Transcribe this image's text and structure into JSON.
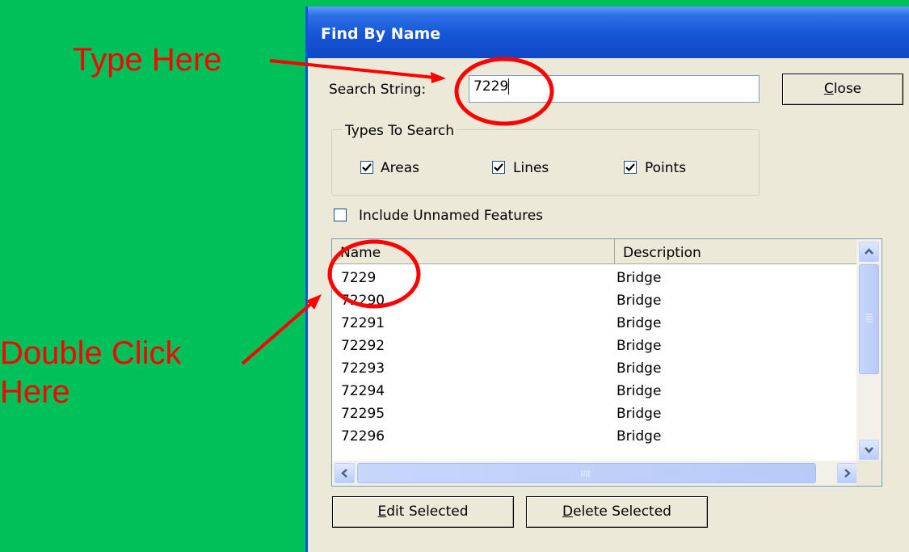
{
  "annotations": {
    "type_here": "Type Here",
    "double_click": "Double Click Here"
  },
  "window": {
    "title": "Find By Name"
  },
  "search": {
    "label": "Search String:",
    "value": "7229"
  },
  "buttons": {
    "close": {
      "accel": "C",
      "rest": "lose"
    },
    "edit_selected": {
      "accel": "E",
      "rest": "dit Selected"
    },
    "delete_selected": {
      "accel": "D",
      "rest": "elete Selected"
    }
  },
  "types_group": {
    "label": "Types To Search",
    "areas": {
      "label": "Areas",
      "checked": true
    },
    "lines": {
      "label": "Lines",
      "checked": true
    },
    "points": {
      "label": "Points",
      "checked": true
    }
  },
  "include_unnamed": {
    "label": "Include Unnamed Features",
    "checked": false
  },
  "results": {
    "columns": [
      "Name",
      "Description"
    ],
    "rows": [
      {
        "name": "7229",
        "description": "Bridge"
      },
      {
        "name": "72290",
        "description": "Bridge"
      },
      {
        "name": "72291",
        "description": "Bridge"
      },
      {
        "name": "72292",
        "description": "Bridge"
      },
      {
        "name": "72293",
        "description": "Bridge"
      },
      {
        "name": "72294",
        "description": "Bridge"
      },
      {
        "name": "72295",
        "description": "Bridge"
      },
      {
        "name": "72296",
        "description": "Bridge"
      }
    ]
  },
  "colors": {
    "background": "#00c05a",
    "annotation": "#ff0000",
    "titlebar": "#1655d6",
    "dialog": "#ece9d8"
  },
  "icons": {
    "scroll_up": "chevron-up-icon",
    "scroll_down": "chevron-down-icon",
    "scroll_left": "chevron-left-icon",
    "scroll_right": "chevron-right-icon",
    "thumb_grip": "grip-icon"
  }
}
